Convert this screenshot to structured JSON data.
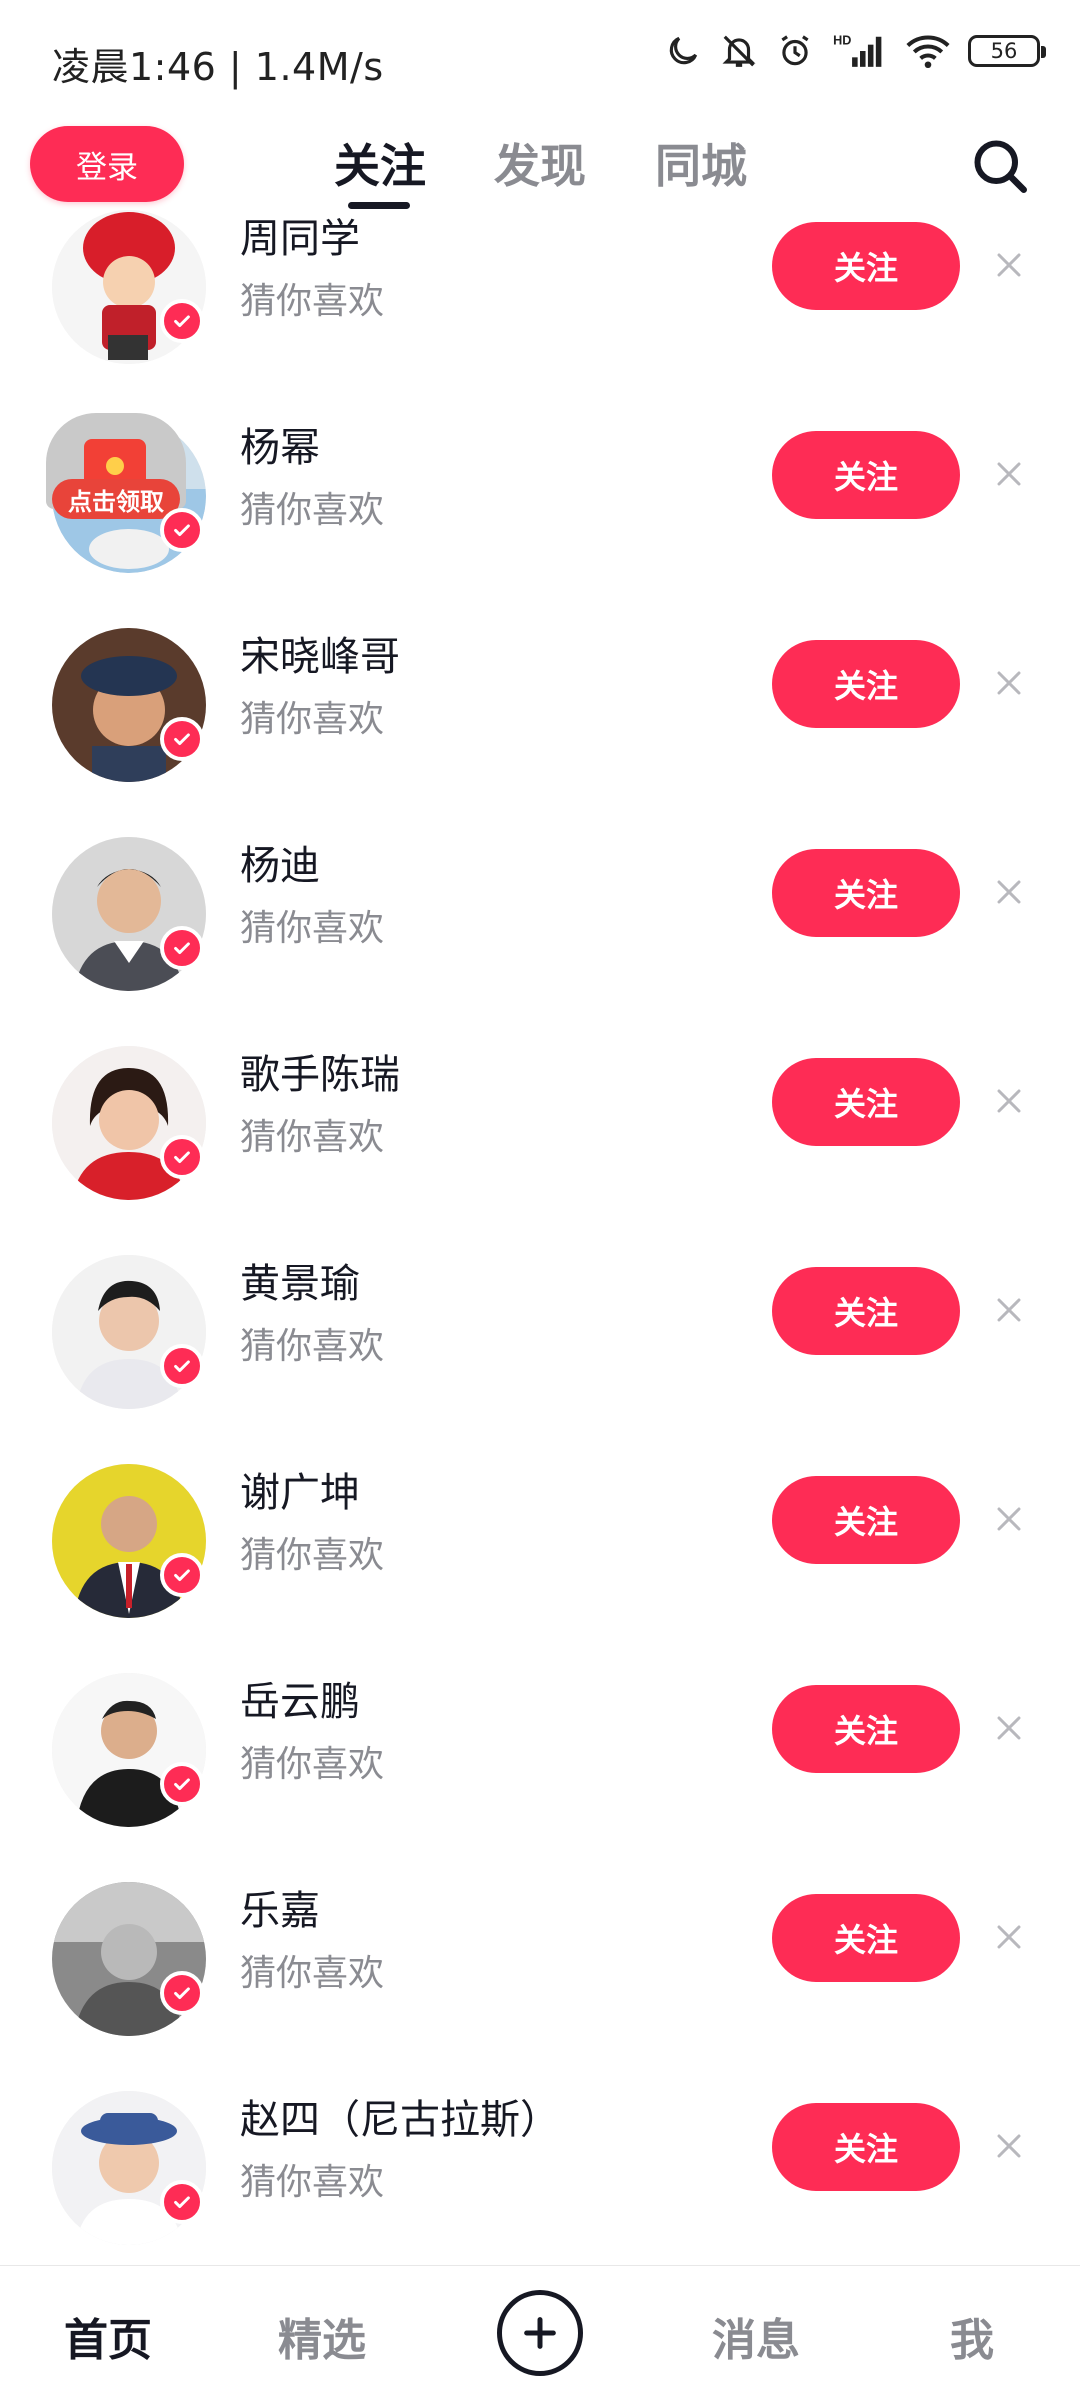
{
  "status_bar": {
    "time_speed": "凌晨1:46 | 1.4M/s",
    "signal_label": "HD",
    "battery": "56"
  },
  "header": {
    "login_label": "登录",
    "tabs": [
      {
        "label": "关注",
        "active": true
      },
      {
        "label": "发现",
        "active": false
      },
      {
        "label": "同城",
        "active": false
      }
    ]
  },
  "accent_color": "#fe2c55",
  "suggestions": [
    {
      "name": "周同学",
      "sub": "猜你喜欢",
      "follow_label": "关注",
      "promo": ""
    },
    {
      "name": "杨幂",
      "sub": "猜你喜欢",
      "follow_label": "关注",
      "promo": "点击领取"
    },
    {
      "name": "宋晓峰哥",
      "sub": "猜你喜欢",
      "follow_label": "关注",
      "promo": ""
    },
    {
      "name": "杨迪",
      "sub": "猜你喜欢",
      "follow_label": "关注",
      "promo": ""
    },
    {
      "name": "歌手陈瑞",
      "sub": "猜你喜欢",
      "follow_label": "关注",
      "promo": ""
    },
    {
      "name": "黄景瑜",
      "sub": "猜你喜欢",
      "follow_label": "关注",
      "promo": ""
    },
    {
      "name": "谢广坤",
      "sub": "猜你喜欢",
      "follow_label": "关注",
      "promo": ""
    },
    {
      "name": "岳云鹏",
      "sub": "猜你喜欢",
      "follow_label": "关注",
      "promo": ""
    },
    {
      "name": "乐嘉",
      "sub": "猜你喜欢",
      "follow_label": "关注",
      "promo": ""
    },
    {
      "name": "赵四（尼古拉斯）",
      "sub": "猜你喜欢",
      "follow_label": "关注",
      "promo": ""
    }
  ],
  "bottom_nav": {
    "home": "首页",
    "select": "精选",
    "messages": "消息",
    "me": "我"
  }
}
